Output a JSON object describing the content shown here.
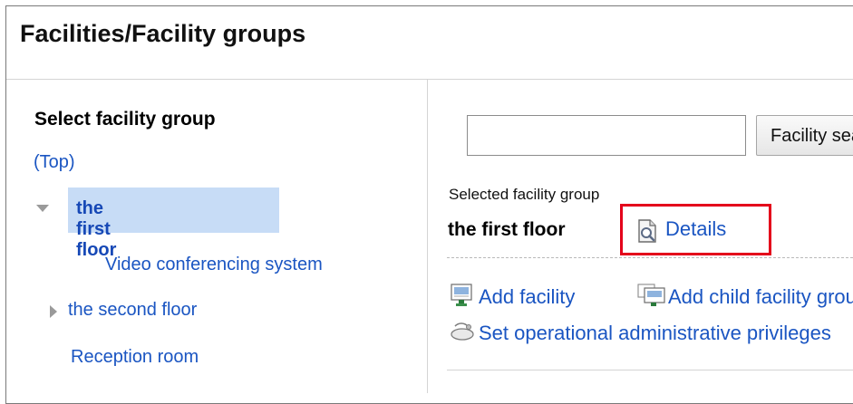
{
  "page": {
    "title": "Facilities/Facility groups"
  },
  "left": {
    "heading": "Select facility group",
    "top_link": "(Top)",
    "tree": [
      {
        "label": "the first floor",
        "state": "expanded",
        "selected": true
      },
      {
        "label": "Video conferencing system",
        "level": 2
      },
      {
        "label": "the second floor",
        "state": "collapsed"
      },
      {
        "label": "Reception room"
      }
    ]
  },
  "right": {
    "search": {
      "value": "",
      "placeholder": "",
      "button_label": "Facility search"
    },
    "selected_group_label": "Selected facility group",
    "selected_group_name": "the first floor",
    "details_label": "Details",
    "actions": {
      "add_facility": "Add facility",
      "add_child": "Add child facility group",
      "set_admin": "Set operational administrative privileges"
    }
  },
  "colors": {
    "link": "#1a55c2",
    "selected_bg": "#c7dcf6",
    "highlight_border": "#e4001b"
  }
}
